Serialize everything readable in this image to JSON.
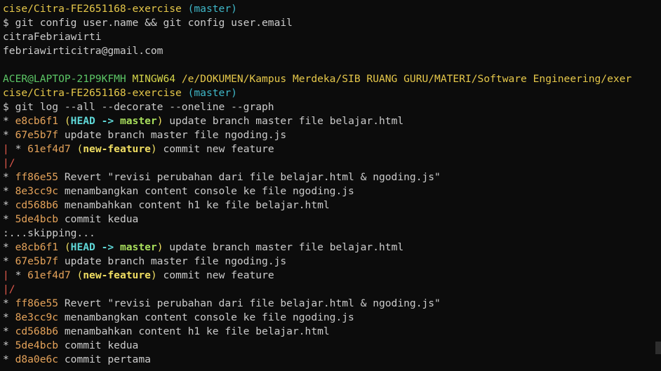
{
  "colors": {
    "background": "#0c0c0c",
    "text": "#cccccc",
    "hash": "#e5a35a",
    "head": "#5fd7d7",
    "branch": "#a8de5c",
    "feature_ref": "#f0de62",
    "graph_branch": "#e0584c",
    "prompt_user": "#5cc766",
    "prompt_host": "#d6d64a",
    "prompt_path": "#e6c84a"
  },
  "lines": [
    {
      "segs": [
        {
          "t": "cise/Citra-FE2651168-exercise",
          "c": "c-prompt-path"
        },
        {
          "t": " (master)",
          "c": "c-prompt-branch"
        }
      ]
    },
    {
      "segs": [
        {
          "t": "$ git config user.name && git config user.email",
          "c": "c-normal"
        }
      ]
    },
    {
      "segs": [
        {
          "t": "citraFebriawirti",
          "c": "c-normal"
        }
      ]
    },
    {
      "segs": [
        {
          "t": "febriawirticitra@gmail.com",
          "c": "c-normal"
        }
      ]
    },
    {
      "segs": [
        {
          "t": "",
          "c": "c-normal"
        }
      ]
    },
    {
      "segs": [
        {
          "t": "ACER@LAPTOP-21P9KFMH",
          "c": "c-prompt-user"
        },
        {
          "t": " MINGW64",
          "c": "c-prompt-host"
        },
        {
          "t": " /e/DOKUMEN/Kampus Merdeka/SIB RUANG GURU/MATERI/Software Engineering/exer",
          "c": "c-prompt-path"
        }
      ]
    },
    {
      "segs": [
        {
          "t": "cise/Citra-FE2651168-exercise",
          "c": "c-prompt-path"
        },
        {
          "t": " (master)",
          "c": "c-prompt-branch"
        }
      ]
    },
    {
      "segs": [
        {
          "t": "$ git log --all --decorate --oneline --graph",
          "c": "c-normal"
        }
      ]
    },
    {
      "segs": [
        {
          "t": "* ",
          "c": "c-graph"
        },
        {
          "t": "e8cb6f1",
          "c": "c-hash"
        },
        {
          "t": " (",
          "c": "c-ref"
        },
        {
          "t": "HEAD -> ",
          "c": "c-head"
        },
        {
          "t": "master",
          "c": "c-branch"
        },
        {
          "t": ")",
          "c": "c-ref"
        },
        {
          "t": " update branch master file belajar.html",
          "c": "c-normal"
        }
      ]
    },
    {
      "segs": [
        {
          "t": "* ",
          "c": "c-graph"
        },
        {
          "t": "67e5b7f",
          "c": "c-hash"
        },
        {
          "t": " update branch master file ngoding.js",
          "c": "c-normal"
        }
      ]
    },
    {
      "segs": [
        {
          "t": "|",
          "c": "c-graph-red"
        },
        {
          "t": " * ",
          "c": "c-graph"
        },
        {
          "t": "61ef4d7",
          "c": "c-hash"
        },
        {
          "t": " (",
          "c": "c-ref"
        },
        {
          "t": "new-feature",
          "c": "c-feature"
        },
        {
          "t": ")",
          "c": "c-ref"
        },
        {
          "t": " commit new feature",
          "c": "c-normal"
        }
      ]
    },
    {
      "segs": [
        {
          "t": "|/",
          "c": "c-graph-red"
        }
      ]
    },
    {
      "segs": [
        {
          "t": "* ",
          "c": "c-graph"
        },
        {
          "t": "ff86e55",
          "c": "c-hash"
        },
        {
          "t": " Revert \"revisi perubahan dari file belajar.html & ngoding.js\"",
          "c": "c-normal"
        }
      ]
    },
    {
      "segs": [
        {
          "t": "* ",
          "c": "c-graph"
        },
        {
          "t": "8e3cc9c",
          "c": "c-hash"
        },
        {
          "t": " menambangkan content console ke file ngoding.js",
          "c": "c-normal"
        }
      ]
    },
    {
      "segs": [
        {
          "t": "* ",
          "c": "c-graph"
        },
        {
          "t": "cd568b6",
          "c": "c-hash"
        },
        {
          "t": " menambahkan content h1 ke file belajar.html",
          "c": "c-normal"
        }
      ]
    },
    {
      "segs": [
        {
          "t": "* ",
          "c": "c-graph"
        },
        {
          "t": "5de4bcb",
          "c": "c-hash"
        },
        {
          "t": " commit kedua",
          "c": "c-normal"
        }
      ]
    },
    {
      "segs": [
        {
          "t": ":...skipping...",
          "c": "c-normal"
        }
      ]
    },
    {
      "segs": [
        {
          "t": "* ",
          "c": "c-graph"
        },
        {
          "t": "e8cb6f1",
          "c": "c-hash"
        },
        {
          "t": " (",
          "c": "c-ref"
        },
        {
          "t": "HEAD -> ",
          "c": "c-head"
        },
        {
          "t": "master",
          "c": "c-branch"
        },
        {
          "t": ")",
          "c": "c-ref"
        },
        {
          "t": " update branch master file belajar.html",
          "c": "c-normal"
        }
      ]
    },
    {
      "segs": [
        {
          "t": "* ",
          "c": "c-graph"
        },
        {
          "t": "67e5b7f",
          "c": "c-hash"
        },
        {
          "t": " update branch master file ngoding.js",
          "c": "c-normal"
        }
      ]
    },
    {
      "segs": [
        {
          "t": "|",
          "c": "c-graph-red"
        },
        {
          "t": " * ",
          "c": "c-graph"
        },
        {
          "t": "61ef4d7",
          "c": "c-hash"
        },
        {
          "t": " (",
          "c": "c-ref"
        },
        {
          "t": "new-feature",
          "c": "c-feature"
        },
        {
          "t": ")",
          "c": "c-ref"
        },
        {
          "t": " commit new feature",
          "c": "c-normal"
        }
      ]
    },
    {
      "segs": [
        {
          "t": "|/",
          "c": "c-graph-red"
        }
      ]
    },
    {
      "segs": [
        {
          "t": "* ",
          "c": "c-graph"
        },
        {
          "t": "ff86e55",
          "c": "c-hash"
        },
        {
          "t": " Revert \"revisi perubahan dari file belajar.html & ngoding.js\"",
          "c": "c-normal"
        }
      ]
    },
    {
      "segs": [
        {
          "t": "* ",
          "c": "c-graph"
        },
        {
          "t": "8e3cc9c",
          "c": "c-hash"
        },
        {
          "t": " menambangkan content console ke file ngoding.js",
          "c": "c-normal"
        }
      ]
    },
    {
      "segs": [
        {
          "t": "* ",
          "c": "c-graph"
        },
        {
          "t": "cd568b6",
          "c": "c-hash"
        },
        {
          "t": " menambahkan content h1 ke file belajar.html",
          "c": "c-normal"
        }
      ]
    },
    {
      "segs": [
        {
          "t": "* ",
          "c": "c-graph"
        },
        {
          "t": "5de4bcb",
          "c": "c-hash"
        },
        {
          "t": " commit kedua",
          "c": "c-normal"
        }
      ]
    },
    {
      "segs": [
        {
          "t": "* ",
          "c": "c-graph"
        },
        {
          "t": "d8a0e6c",
          "c": "c-hash"
        },
        {
          "t": " commit pertama",
          "c": "c-normal"
        }
      ]
    }
  ]
}
